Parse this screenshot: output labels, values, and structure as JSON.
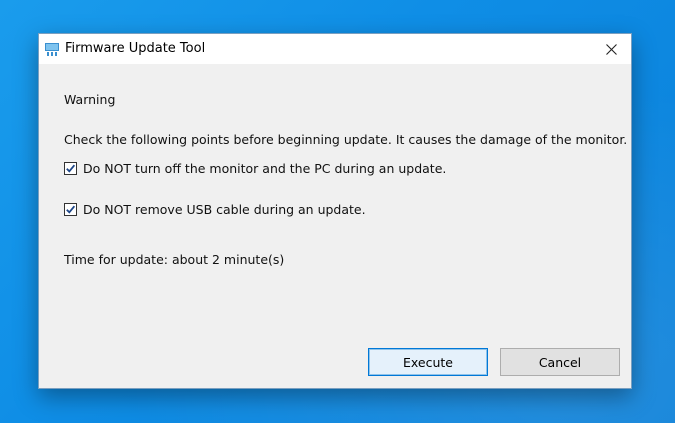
{
  "window": {
    "title": "Firmware Update Tool",
    "close_glyph": "✕",
    "app_icon": "monitor-firmware-icon"
  },
  "dialog": {
    "heading": "Warning",
    "instruction": "Check the following points before beginning update. It causes the damage of the monitor.",
    "checks": [
      {
        "label": "Do NOT turn off the monitor and the PC during an update.",
        "checked": true
      },
      {
        "label": "Do NOT remove USB cable during an update.",
        "checked": true
      }
    ],
    "time_note": "Time for update: about 2 minute(s)"
  },
  "buttons": {
    "execute_label": "Execute",
    "cancel_label": "Cancel"
  },
  "colors": {
    "desktop_blue": "#0f8ee6",
    "accent": "#0078d7",
    "window_bg": "#f0f0f0",
    "check_mark": "#1c4587"
  }
}
